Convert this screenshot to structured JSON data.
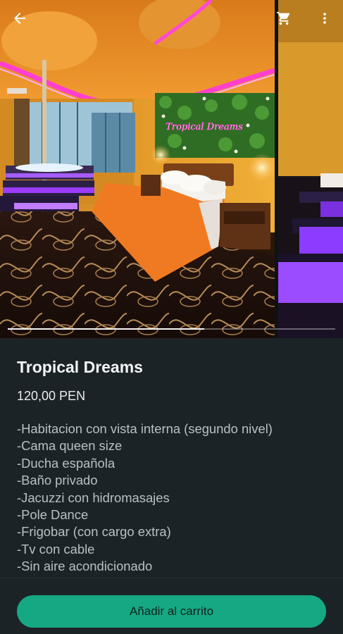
{
  "header": {
    "back_icon": "arrow-left-icon",
    "cart_icon": "cart-icon",
    "menu_icon": "more-vert-icon"
  },
  "gallery": {
    "photo_count_visible": 2,
    "scroll_progress": 0.6
  },
  "product": {
    "title": "Tropical Dreams",
    "price": "120,00 PEN",
    "neon_sign": "Tropical Dreams",
    "features": [
      "-Habitacion con vista interna (segundo nivel)",
      "-Cama queen size",
      "-Ducha española",
      "-Baño privado",
      "-Jacuzzi con hidromasajes",
      "-Pole Dance",
      "-Frigobar (con cargo extra)",
      "-Tv con cable",
      "-Sin aire acondicionado"
    ]
  },
  "footer": {
    "add_to_cart_label": "Añadir al carrito"
  },
  "colors": {
    "background": "#1b2327",
    "accent": "#16a883",
    "neon_pink": "#ff3fd0",
    "neon_purple": "#9b3cff",
    "bedspread": "#f07a22"
  }
}
